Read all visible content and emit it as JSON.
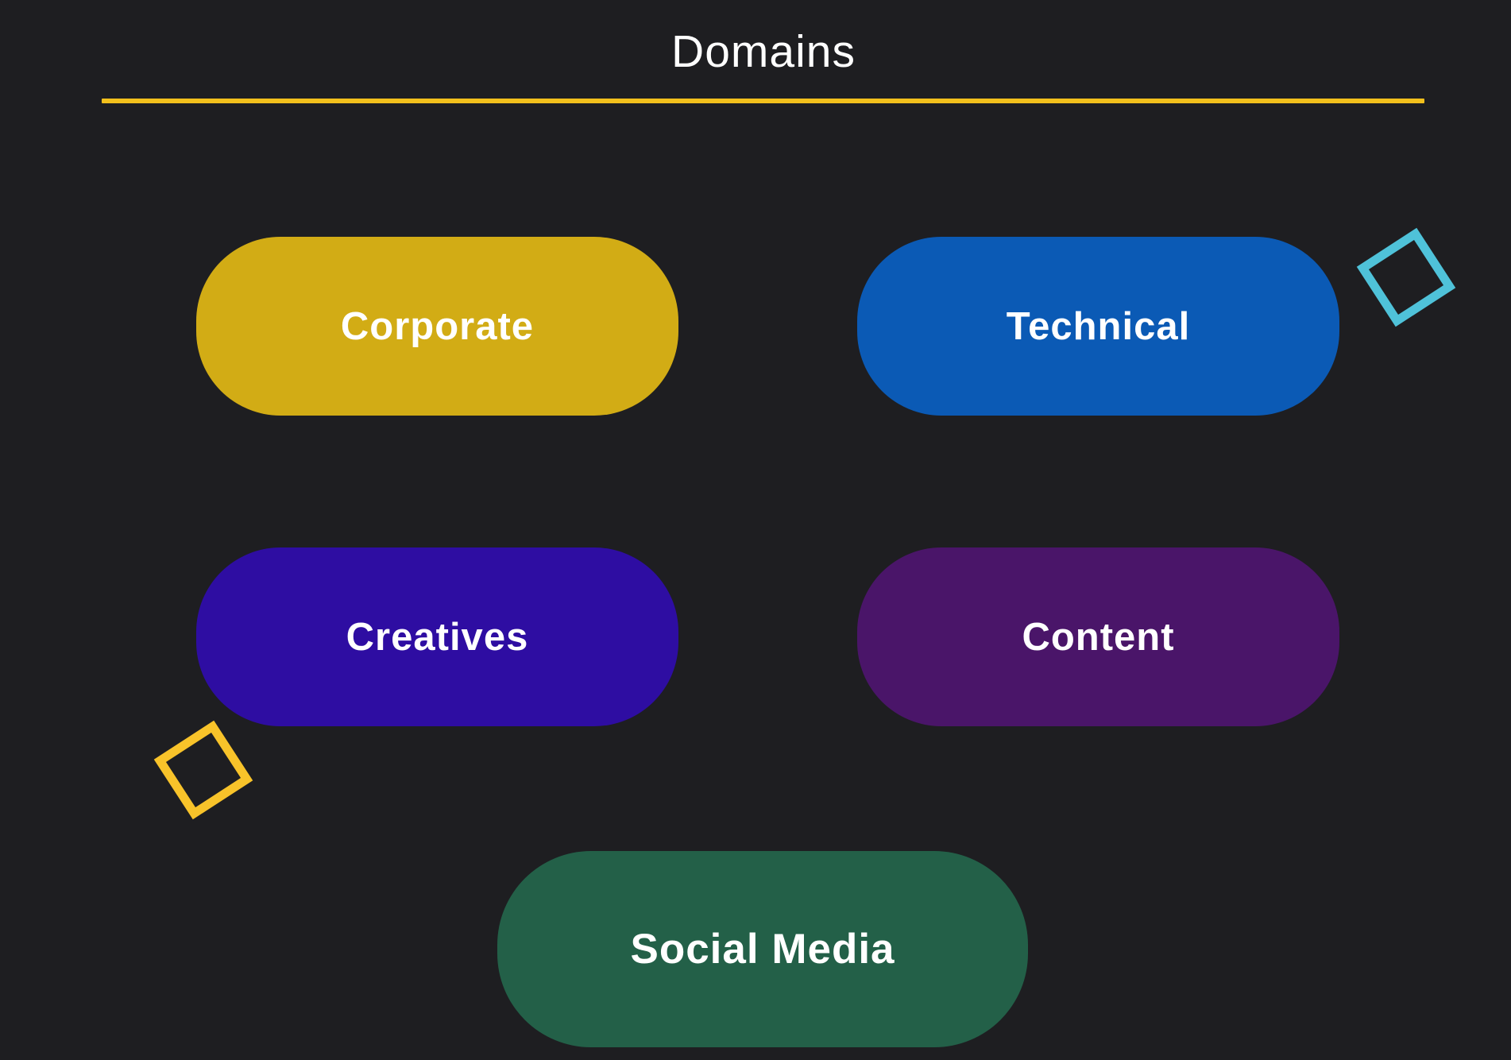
{
  "header": {
    "title": "Domains",
    "divider_color": "#f2c01c"
  },
  "domains": [
    {
      "label": "Corporate",
      "color": "#d2ac15"
    },
    {
      "label": "Technical",
      "color": "#0b5ab5"
    },
    {
      "label": "Creatives",
      "color": "#2e0da2"
    },
    {
      "label": "Content",
      "color": "#4a1569"
    },
    {
      "label": "Social Media",
      "color": "#236048"
    }
  ],
  "decorations": {
    "cyan_square": {
      "icon": "outlined-square-icon",
      "color": "#4fc2d9"
    },
    "yellow_square": {
      "icon": "outlined-square-icon",
      "color": "#f8c32a"
    }
  },
  "background_color": "#1e1e21"
}
